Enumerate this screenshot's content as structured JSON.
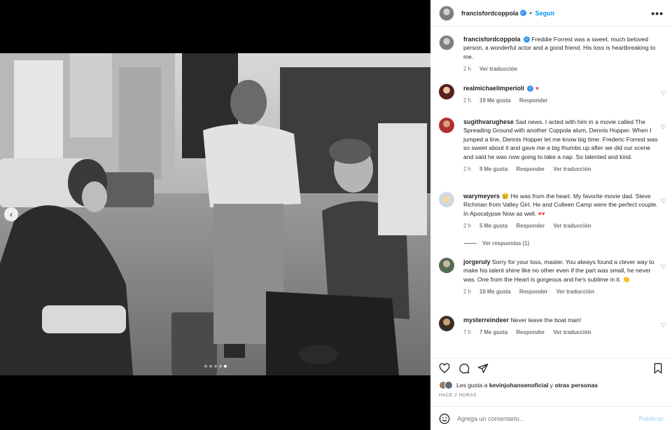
{
  "post": {
    "username": "francisfordcoppola",
    "follow_label": "Seguir",
    "separator": "•",
    "more_label": "•••",
    "photo_dots": 5,
    "photo_active_dot": 4
  },
  "caption": {
    "username": "francisfordcoppola",
    "text": "Freddie Forrest was a sweet, much beloved person, a wonderful actor and a good friend. His loss is heartbreaking to me.",
    "time": "2 h",
    "translate": "Ver traducción"
  },
  "comments": [
    {
      "username": "realmichaelimperioli",
      "verified": true,
      "text": "",
      "emoji": "♥",
      "time": "2 h",
      "likes": "19 Me gusta",
      "reply": "Responder",
      "translate": ""
    },
    {
      "username": "sugithvarughese",
      "verified": false,
      "text": "Sad news. I acted with him in a movie called The Spreading Ground with another Coppola alum, Dennis Hopper. When I jumped a line, Dennis Hopper let me know big time. Frederic Forrest was so sweet about it and gave me a big thumbs up after we did our scene and said he was now going to take a nap. So talented and kind.",
      "emoji": "",
      "time": "2 h",
      "likes": "9 Me gusta",
      "reply": "Responder",
      "translate": "Ver traducción"
    },
    {
      "username": "warymeyers",
      "verified": false,
      "text": "He was from the heart. My favorite movie dad. Steve Richman from Valley Girl. He and Colleen Camp were the perfect couple. In Apocalypse Now as well.",
      "prefix_emoji": "😢",
      "emoji": "♥♥",
      "time": "2 h",
      "likes": "5 Me gusta",
      "reply": "Responder",
      "translate": "Ver traducción"
    },
    {
      "username": "jorgeruly",
      "verified": false,
      "text": "Sorry for your loss, master. You always found a clever way to make his talent shine like no other even if the part was small, he never was. One from the Heart is gorgeous and he's sublime in it.",
      "emoji": "👏",
      "time": "2 h",
      "likes": "10 Me gusta",
      "reply": "Responder",
      "translate": "Ver traducción"
    },
    {
      "username": "mysterreindeer",
      "verified": false,
      "text": "Never leave the boat man!",
      "emoji": "",
      "time": "7 h",
      "likes": "7 Me gusta",
      "reply": "Responder",
      "translate": "Ver traducción"
    }
  ],
  "view_replies": "Ver respuestas (1)",
  "likes_line": {
    "prefix": "Les gusta a",
    "user": "kevinjohansenoficial",
    "joiner": "y",
    "others": "otras personas"
  },
  "when": "HACE 2 HORAS",
  "add_comment": {
    "placeholder": "Agrega un comentario...",
    "publish": "Publicar"
  },
  "colors": {
    "accent": "#0095f6",
    "heart": "#ed4956",
    "muted": "#737373",
    "verified": "#3897f0"
  }
}
